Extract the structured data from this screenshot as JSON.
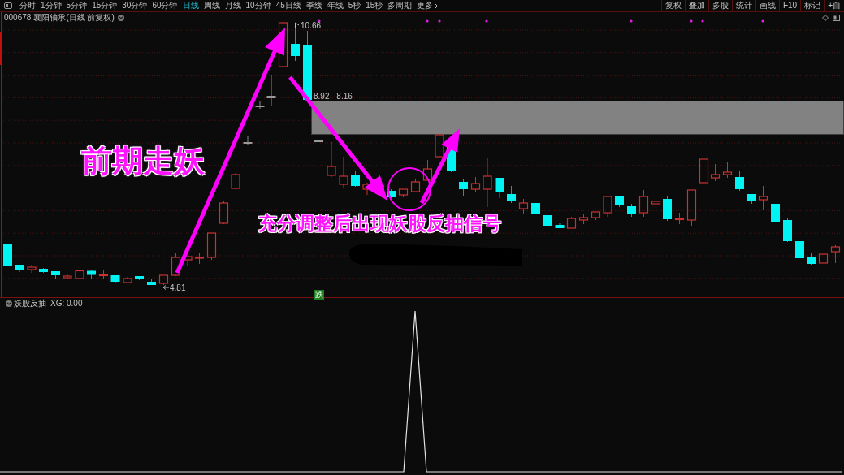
{
  "toolbar": {
    "periods": [
      {
        "label": "分时",
        "selected": false
      },
      {
        "label": "1分钟",
        "selected": false
      },
      {
        "label": "5分钟",
        "selected": false
      },
      {
        "label": "15分钟",
        "selected": false
      },
      {
        "label": "30分钟",
        "selected": false
      },
      {
        "label": "60分钟",
        "selected": false
      },
      {
        "label": "日线",
        "selected": true
      },
      {
        "label": "周线",
        "selected": false
      },
      {
        "label": "月线",
        "selected": false
      },
      {
        "label": "10分钟",
        "selected": false
      },
      {
        "label": "45日线",
        "selected": false
      },
      {
        "label": "季线",
        "selected": false
      },
      {
        "label": "年线",
        "selected": false
      },
      {
        "label": "5秒",
        "selected": false
      },
      {
        "label": "15秒",
        "selected": false
      },
      {
        "label": "多周期",
        "selected": false
      }
    ],
    "more": "更多",
    "tools": [
      "复权",
      "叠加",
      "多股",
      "统计",
      "画线",
      "F10",
      "标记",
      "+自"
    ]
  },
  "chart_header": {
    "symbol": "000678",
    "title": "襄阳轴承(日线 前复权)"
  },
  "main_chart": {
    "high_label": "10.66",
    "zone_label": "8.92 - 8.16",
    "low_label": "4.81",
    "signal_tag": "跌"
  },
  "annotations": {
    "headline": "前期走妖",
    "caption": "充分调整后出现妖股反抽信号"
  },
  "indicator": {
    "name": "妖股反抽",
    "reading": "XG: 0.00"
  }
}
